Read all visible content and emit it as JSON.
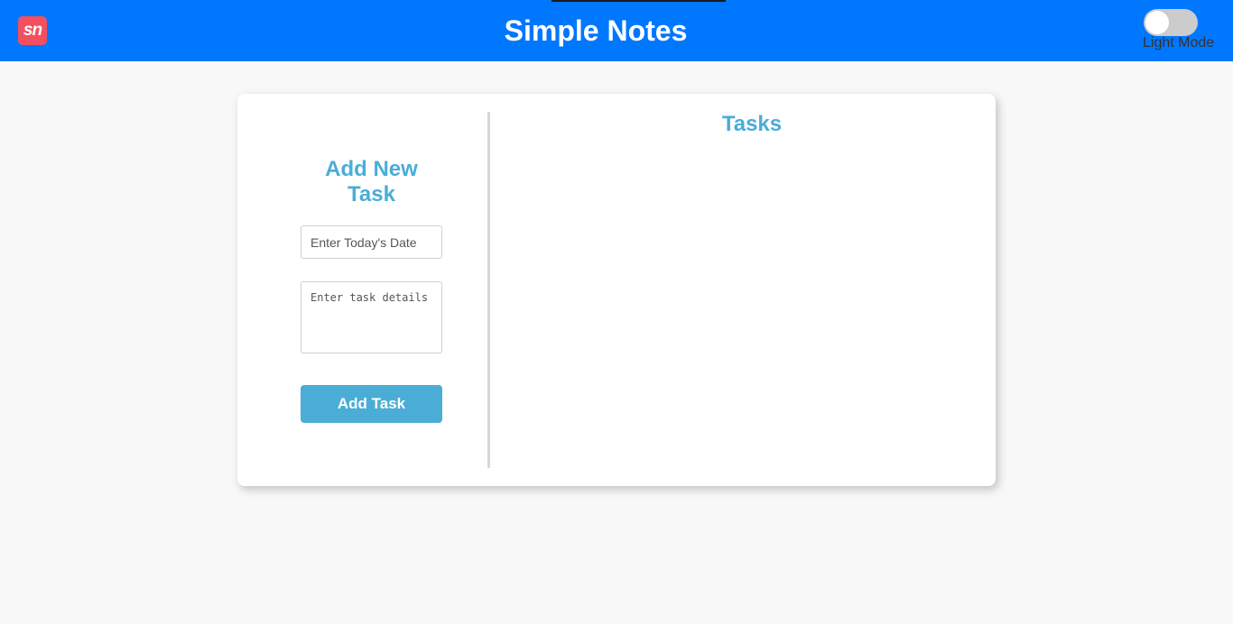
{
  "header": {
    "logo_text": "sn",
    "title": "Simple Notes",
    "theme_toggle": {
      "label": "Light Mode",
      "checked": false
    }
  },
  "form": {
    "title": "Add New Task",
    "date_placeholder": "Enter Today's Date",
    "date_value": "",
    "details_placeholder": "Enter task details",
    "details_value": "",
    "submit_label": "Add Task"
  },
  "tasks": {
    "title": "Tasks",
    "items": []
  },
  "colors": {
    "header_bg": "#0077ff",
    "accent": "#4aadd6",
    "logo_bg": "#f25060",
    "page_bg": "#f8f8f8"
  }
}
